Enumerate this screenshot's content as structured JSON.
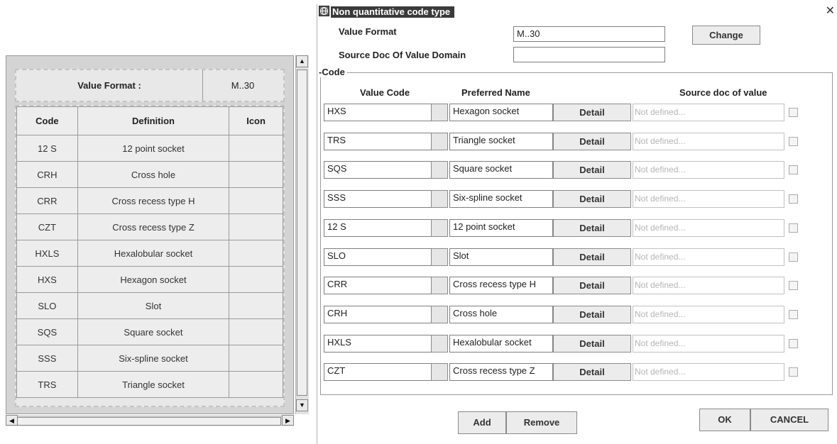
{
  "left_panel": {
    "value_format_label": "Value Format :",
    "value_format_value": "M..30",
    "columns": [
      "Code",
      "Definition",
      "Icon"
    ],
    "rows": [
      {
        "code": "12 S",
        "definition": "12 point socket",
        "icon": ""
      },
      {
        "code": "CRH",
        "definition": "Cross hole",
        "icon": ""
      },
      {
        "code": "CRR",
        "definition": "Cross recess type H",
        "icon": ""
      },
      {
        "code": "CZT",
        "definition": "Cross recess type Z",
        "icon": ""
      },
      {
        "code": "HXLS",
        "definition": "Hexalobular socket",
        "icon": ""
      },
      {
        "code": "HXS",
        "definition": "Hexagon socket",
        "icon": ""
      },
      {
        "code": "SLO",
        "definition": "Slot",
        "icon": ""
      },
      {
        "code": "SQS",
        "definition": "Square socket",
        "icon": ""
      },
      {
        "code": "SSS",
        "definition": "Six-spline socket",
        "icon": ""
      },
      {
        "code": "TRS",
        "definition": "Triangle socket",
        "icon": ""
      }
    ],
    "scroll_up": "▲",
    "scroll_down": "▼",
    "scroll_left": "◀",
    "scroll_right": "▶"
  },
  "dialog": {
    "title": "Non quantitative code type",
    "close": "✕",
    "value_format_label": "Value Format",
    "value_format_value": "M..30",
    "change_button": "Change",
    "source_doc_label": "Source Doc Of Value Domain",
    "source_doc_value": "",
    "code_group_label": "Code",
    "col_value_code": "Value Code",
    "col_preferred_name": "Preferred Name",
    "col_source_doc": "Source doc of value",
    "detail_label": "Detail",
    "rows": [
      {
        "code": "HXS",
        "name": "Hexagon socket",
        "source": "Not defined..."
      },
      {
        "code": "TRS",
        "name": "Triangle socket",
        "source": "Not defined..."
      },
      {
        "code": "SQS",
        "name": "Square socket",
        "source": "Not defined..."
      },
      {
        "code": "SSS",
        "name": "Six-spline socket",
        "source": "Not defined..."
      },
      {
        "code": "12 S",
        "name": "12 point socket",
        "source": "Not defined..."
      },
      {
        "code": "SLO",
        "name": "Slot",
        "source": "Not defined..."
      },
      {
        "code": "CRR",
        "name": "Cross recess type H",
        "source": "Not defined..."
      },
      {
        "code": "CRH",
        "name": "Cross hole",
        "source": "Not defined..."
      },
      {
        "code": "HXLS",
        "name": "Hexalobular socket",
        "source": "Not defined..."
      },
      {
        "code": "CZT",
        "name": "Cross recess type Z",
        "source": "Not defined..."
      }
    ],
    "add_button": "Add",
    "remove_button": "Remove",
    "ok_button": "OK",
    "cancel_button": "CANCEL"
  }
}
